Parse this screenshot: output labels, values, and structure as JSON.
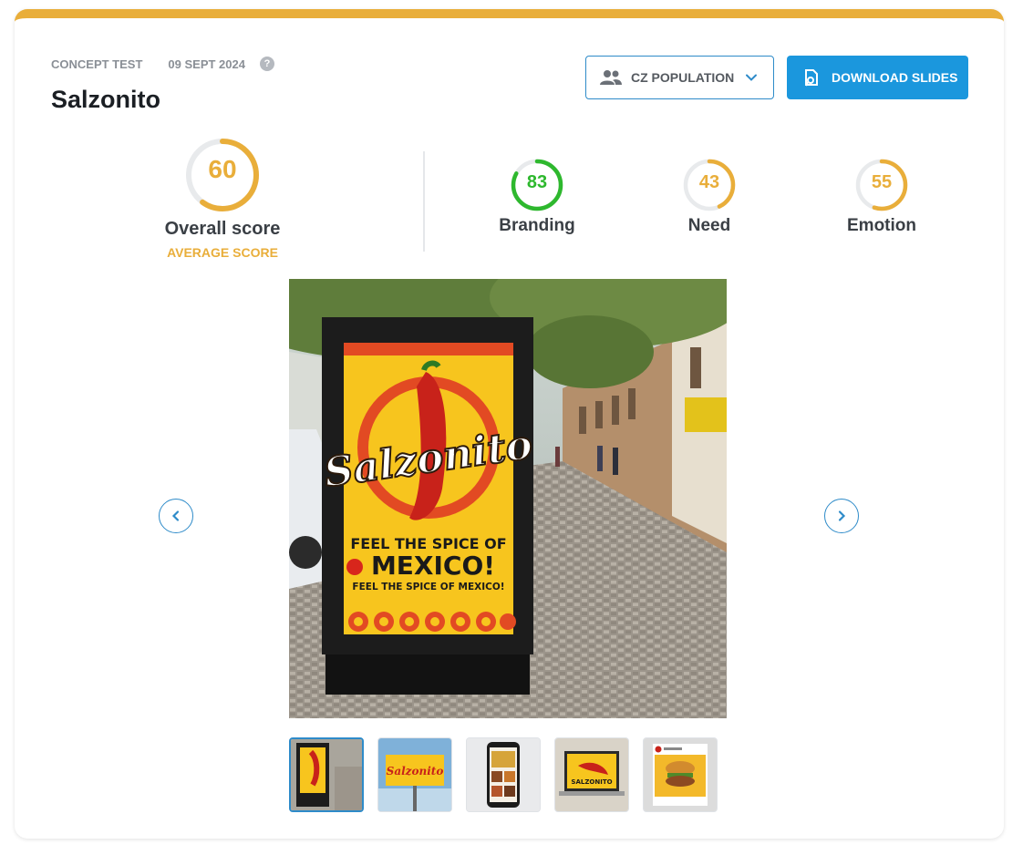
{
  "header": {
    "test_type": "CONCEPT TEST",
    "date": "09 SEPT 2024",
    "help_icon": "question-icon",
    "title": "Salzonito"
  },
  "toolbar": {
    "population_label": "CZ POPULATION",
    "population_icon": "people-icon",
    "download_label": "DOWNLOAD SLIDES",
    "download_icon": "download-slides-icon"
  },
  "scores": {
    "overall": {
      "value": "60",
      "fraction": 0.6,
      "label": "Overall score",
      "rating": "AVERAGE SCORE"
    },
    "branding": {
      "value": "83",
      "fraction": 0.83,
      "label": "Branding"
    },
    "need": {
      "value": "43",
      "fraction": 0.43,
      "label": "Need"
    },
    "emotion": {
      "value": "55",
      "fraction": 0.55,
      "label": "Emotion"
    }
  },
  "poster": {
    "brand": "Salzonito",
    "headline": "FEEL THE SPICE OF",
    "headline_big": "MEXICO!",
    "tagline": "FEEL THE SPICE OF MEXICO!"
  },
  "thumbnails": {
    "count": 5,
    "active_index": 0,
    "items": [
      "street poster",
      "billboard",
      "phone feed",
      "laptop",
      "social post"
    ],
    "billboard_brand": "Salzonito",
    "laptop_brand": "SALZONITO"
  },
  "colors": {
    "accent": "#E9AE3A",
    "primary": "#1B97DD",
    "good": "#2EB82E",
    "track": "#E8EAEC"
  }
}
